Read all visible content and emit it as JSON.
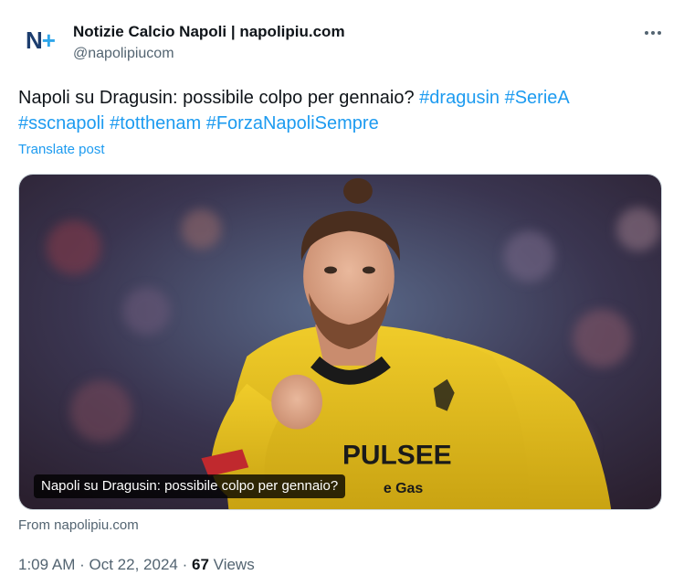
{
  "author": {
    "avatar_text_n": "N",
    "avatar_text_plus": "+",
    "display_name": "Notizie Calcio Napoli | napolipiu.com",
    "handle": "@napolipiucom"
  },
  "post": {
    "text": "Napoli su Dragusin: possibile colpo per gennaio?",
    "hashtags": [
      "#dragusin",
      "#SerieA",
      "#sscnapoli",
      "#totthenam",
      "#ForzaNapoliSempre"
    ],
    "translate_label": "Translate post"
  },
  "card": {
    "caption": "Napoli su Dragusin: possibile colpo per gennaio?",
    "jersey_text": "PULSEE",
    "jersey_subtext": "e Gas",
    "from_prefix": "From",
    "from_site": "napolipiu.com"
  },
  "meta": {
    "time": "1:09 AM",
    "separator": "·",
    "date": "Oct 22, 2024",
    "views_count": "67",
    "views_label": "Views"
  },
  "colors": {
    "accent": "#1d9bf0",
    "text": "#0f1419",
    "secondary": "#536471",
    "jersey": "#e8c21e"
  }
}
